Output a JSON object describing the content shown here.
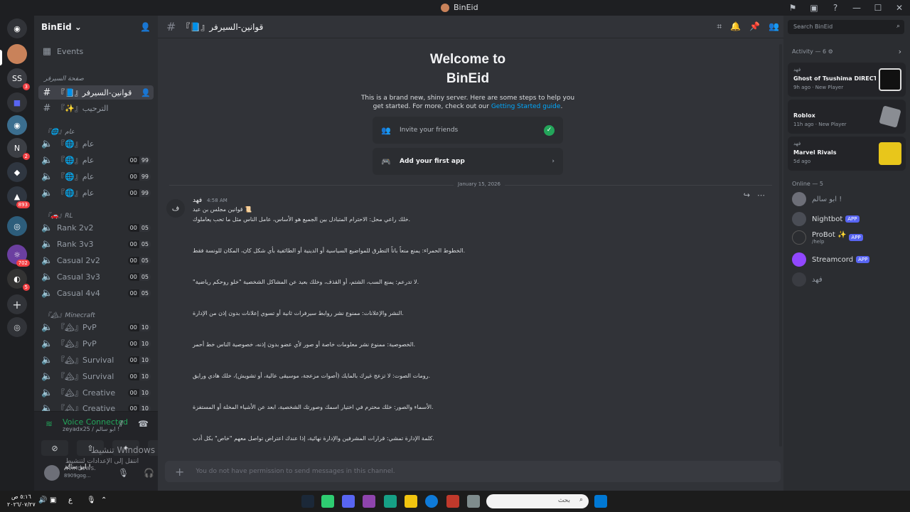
{
  "window": {
    "title": "BinEid"
  },
  "servers": [
    {
      "letter": "⌂",
      "color": "#5865f2",
      "badge": ""
    },
    {
      "letter": "👤",
      "color": "#c9825a",
      "badge": ""
    },
    {
      "letter": "SS",
      "color": "#313338",
      "badge": "3"
    },
    {
      "letter": "■",
      "color": "#5865f2",
      "badge": ""
    },
    {
      "letter": "◉",
      "color": "#3b6e8f",
      "badge": ""
    },
    {
      "letter": "N",
      "color": "#3c3f45",
      "badge": "2"
    },
    {
      "letter": "▲",
      "color": "#2f3640",
      "badge": "893"
    },
    {
      "letter": "◎",
      "color": "#2d5d7b",
      "badge": ""
    },
    {
      "letter": "☼",
      "color": "#6b3fa0",
      "badge": "702"
    },
    {
      "letter": "◐",
      "color": "#333",
      "badge": "5"
    }
  ],
  "guild": {
    "name": "BinEid"
  },
  "events_label": "Events",
  "channels": {
    "cat_server": "صفحة السيرفر",
    "ch_rules": "『📘』قوانين-السيرفر",
    "ch_welcome": "『✨』الترحيب",
    "cat_general": "『🌐』عام",
    "ch_general_text": "『🌐』عام",
    "vc_general": [
      "『🌐』عام",
      "『🌐』عام",
      "『🌐』عام"
    ],
    "cat_rl": "『🚗』RL",
    "rl": [
      "Rank 2v2",
      "Rank 3v3",
      "Casual 2v2",
      "Casual 3v3",
      "Casual 4v4"
    ],
    "cat_mc": "『🏔』Minecraft",
    "mc": [
      "『🏔』PvP",
      "『🏔』PvP",
      "『🏔』Survival",
      "『🏔』Survival",
      "『🏔』Creative",
      "『🏔』Creative"
    ],
    "count_a": "00",
    "count_99": "99",
    "count_05": "05",
    "count_10": "10"
  },
  "voice": {
    "status": "Voice Connected",
    "sub": "zeyadx25 / ابو سالم !"
  },
  "user": {
    "name": "ابو سالم !",
    "tag": "8909gog..."
  },
  "watermark": {
    "title": "تنشيط Windows",
    "sub": "انتقل إلى الإعدادات لتنشيط Windows."
  },
  "header": {
    "channel": "『📘』قوانين-السيرفر"
  },
  "welcome": {
    "line1": "Welcome to",
    "line2": "BinEid",
    "desc1": "This is a brand new, shiny server. Here are some steps to help you",
    "desc2": "get started. For more, check out our",
    "link": "Getting Started guide",
    "dot": ".",
    "invite": "Invite your friends",
    "app": "Add your first app"
  },
  "divider": "January 15, 2026",
  "message": {
    "author": "فهد",
    "time": "4:58 AM",
    "lines": [
      "قوانين مجلس بن عيد 📜",
      "خلك راعي محل: الاحترام المتبادل بين الجميع هو الأساس، عامل الناس مثل ما تحب يعاملوك.",
      "الخطوط الحمراء: يمنع منعاً باتاً التطرق للمواضيع السياسية أو الدينية أو الطائفية بأي شكل كان، المكان للونسة فقط.",
      "\"لا تدرعم: يمنع السب، الشتم، أو القذف، وخلك بعيد عن المشاكل الشخصية \"خلو روحكم رياضية.",
      "النشر والإعلانات: ممنوع نشر روابط سيرفرات ثانية أو تسوي إعلانات بدون إذن من الإدارة.",
      "الخصوصية: ممنوع نشر معلومات خاصة أو صور لأي عضو بدون إذنه، خصوصية الناس خط أحمر.",
      "رومات الصوت: لا تزعج غيرك بالمايك (أصوات مزعجة، موسيقى عالية، أو تشويش)، خلك هادي ورايق.",
      "الأسماء والصور: خلك محترم في اختيار اسمك وصورتك الشخصية، ابعد عن الأشياء المخلة أو المستفزة.",
      "كلمة الإدارة تمشي: قرارات المشرفين والإدارة نهائية، إذا عندك اعتراض تواصل معهم \"خاص\" بكل أدب."
    ]
  },
  "composer": {
    "placeholder": "You do not have permission to send messages in this channel."
  },
  "search": {
    "placeholder": "Search BinEid"
  },
  "activity": {
    "head": "Activity — 6",
    "items": [
      {
        "user": "فهد",
        "game": "Ghost of Tsushima DIRECT...",
        "meta": "9h ago · New Player"
      },
      {
        "user": "",
        "game": "Roblox",
        "meta": "11h ago · New Player"
      },
      {
        "user": "فهد",
        "game": "Marvel Rivals",
        "meta": "5d ago"
      }
    ]
  },
  "online": {
    "head": "Online — 5",
    "members": [
      {
        "name": "ابو سالم !",
        "sub": "",
        "app": ""
      },
      {
        "name": "Nightbot",
        "sub": "",
        "app": "APP"
      },
      {
        "name": "ProBot ✨",
        "sub": "/help",
        "app": "APP"
      },
      {
        "name": "Streamcord",
        "sub": "",
        "app": "APP"
      },
      {
        "name": "فهد",
        "sub": "",
        "app": ""
      }
    ]
  },
  "taskbar": {
    "time": "٥:١٦ ص",
    "date": "٢٠٢٦/٠٧/٢٧",
    "search": "بحث",
    "lang": "ع"
  }
}
